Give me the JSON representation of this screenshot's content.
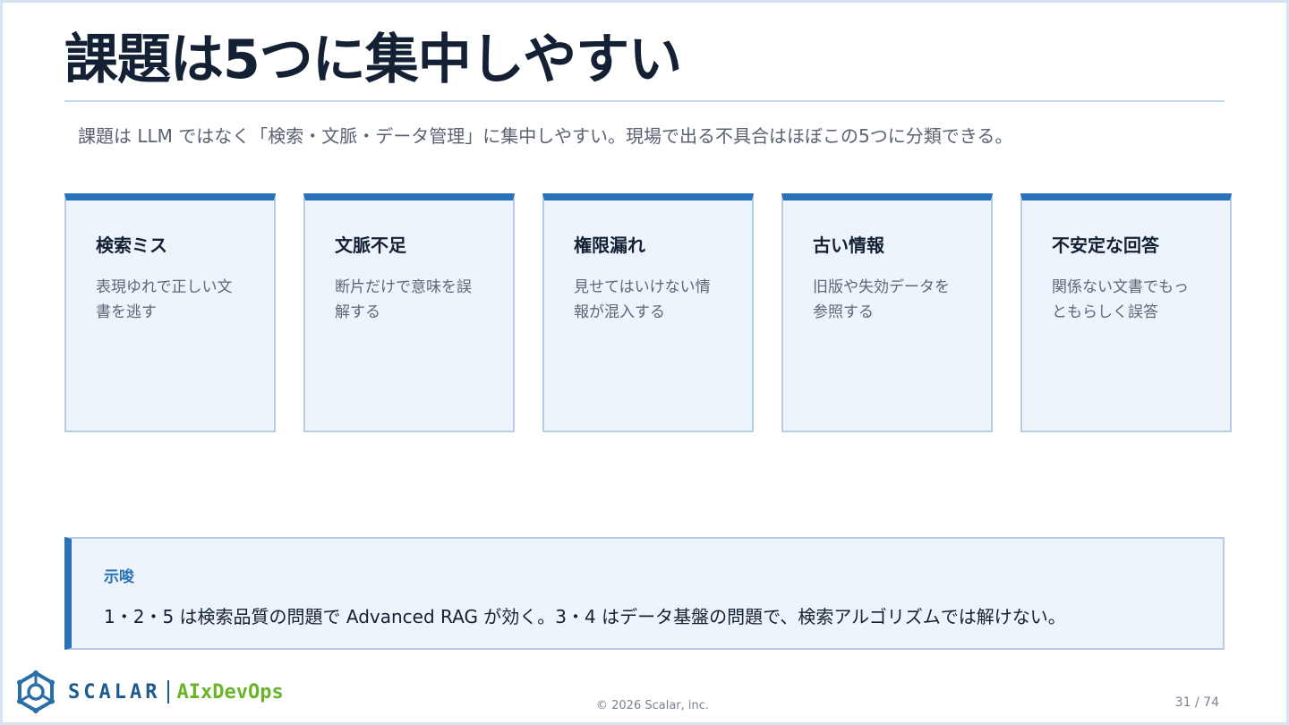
{
  "slide": {
    "title": "課題は5つに集中しやすい",
    "subtitle": "課題は LLM ではなく「検索・文脈・データ管理」に集中しやすい。現場で出る不具合はほぼこの5つに分類できる。"
  },
  "cards": [
    {
      "title": "検索ミス",
      "description": "表現ゆれで正しい文書を逃す"
    },
    {
      "title": "文脈不足",
      "description": "断片だけで意味を誤解する"
    },
    {
      "title": "権限漏れ",
      "description": "見せてはいけない情報が混入する"
    },
    {
      "title": "古い情報",
      "description": "旧版や失効データを参照する"
    },
    {
      "title": "不安定な回答",
      "description": "関係ない文書でもっともらしく誤答"
    }
  ],
  "insight": {
    "label": "示唆",
    "text": "1・2・5 は検索品質の問題で Advanced RAG が効く。3・4 はデータ基盤の問題で、検索アルゴリズムでは解けない。"
  },
  "footer": {
    "brand": "SCALAR",
    "brand_sub": "AIxDevOps",
    "logo_icon": "scalar-logo-icon",
    "copyright": "© 2026 Scalar, inc.",
    "page": "31 / 74"
  },
  "colors": {
    "accent": "#2a72b8",
    "card_bg": "#eef4fb",
    "card_border": "#b7cde6",
    "brand": "#1e5b8f",
    "brand_sub": "#6ab42a"
  }
}
